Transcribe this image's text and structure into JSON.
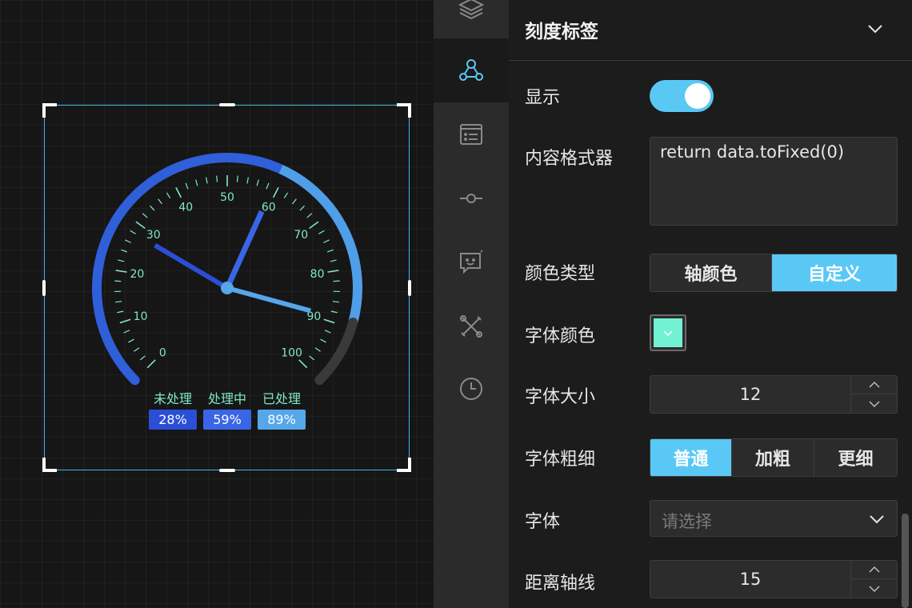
{
  "gauge": {
    "min": 0,
    "max": 100,
    "tick_labels": [
      "0",
      "10",
      "20",
      "30",
      "40",
      "50",
      "60",
      "70",
      "80",
      "90",
      "100"
    ],
    "label_color": "#7fe8c8",
    "arc_colors": [
      "#2f5fd9",
      "#4f9ee8",
      "#3a3a3a"
    ],
    "series": [
      {
        "label": "未处理",
        "value": 28,
        "display": "28%",
        "color": "#2a4fd6"
      },
      {
        "label": "处理中",
        "value": 59,
        "display": "59%",
        "color": "#3a66e6"
      },
      {
        "label": "已处理",
        "value": 89,
        "display": "89%",
        "color": "#56a6ea"
      }
    ]
  },
  "sidebar_icons": [
    {
      "name": "layers-icon",
      "active": false
    },
    {
      "name": "nodes-icon",
      "active": true
    },
    {
      "name": "list-icon",
      "active": false
    },
    {
      "name": "axis-node-icon",
      "active": false
    },
    {
      "name": "tooltip-icon",
      "active": false
    },
    {
      "name": "tools-icon",
      "active": false
    },
    {
      "name": "clock-icon",
      "active": false
    }
  ],
  "panel": {
    "title": "刻度标签",
    "show_label": "显示",
    "show_enabled": true,
    "formatter_label": "内容格式器",
    "formatter_value": "return data.toFixed(0)",
    "color_type_label": "颜色类型",
    "color_type_options": [
      "轴颜色",
      "自定义"
    ],
    "color_type_selected": "自定义",
    "font_color_label": "字体颜色",
    "font_color": "#72f2d2",
    "font_size_label": "字体大小",
    "font_size": "12",
    "font_weight_label": "字体粗细",
    "font_weight_options": [
      "普通",
      "加粗",
      "更细"
    ],
    "font_weight_selected": "普通",
    "font_family_label": "字体",
    "font_family_placeholder": "请选择",
    "axis_distance_label": "距离轴线",
    "axis_distance": "15"
  }
}
